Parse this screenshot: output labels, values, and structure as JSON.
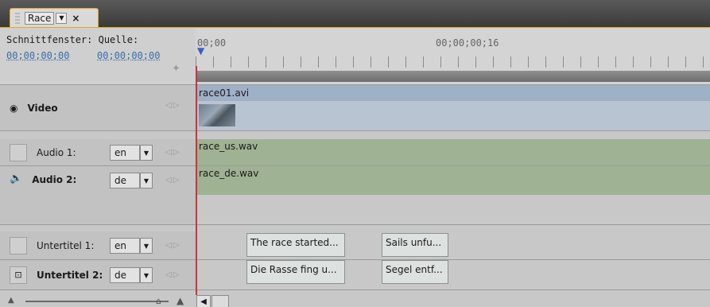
{
  "tab": {
    "label": "Race",
    "close": "×",
    "dropdown": "▼"
  },
  "header": {
    "title": "Schnittfenster: Quelle:",
    "timecode_in": "00;00;00;00",
    "timecode_out": "00;00;00;00",
    "ruler_start": "00;00",
    "ruler_mid": "00;00;00;16",
    "snap_icon": "wand-icon"
  },
  "tracks": {
    "video": {
      "label": "Video",
      "eye_icon": "eye-icon",
      "clip": "race01.avi"
    },
    "audio1": {
      "label": "Audio 1:",
      "lang": "en",
      "clip": "race_us.wav"
    },
    "audio2": {
      "label": "Audio 2:",
      "lang": "de",
      "speaker_icon": "speaker-icon",
      "clip": "race_de.wav"
    },
    "sub1": {
      "label": "Untertitel 1:",
      "lang": "en",
      "clips": [
        "The race started...",
        "Sails unfu..."
      ]
    },
    "sub2": {
      "label": "Untertitel 2:",
      "lang": "de",
      "subtitle_icon": "subtitle-icon",
      "clips": [
        "Die Rasse fing u...",
        "Segel entf..."
      ]
    }
  },
  "colors": {
    "accent": "#e3a91c",
    "video_clip": "#b9c4d2",
    "audio_clip": "#9fb293",
    "playhead": "#cc3333"
  }
}
